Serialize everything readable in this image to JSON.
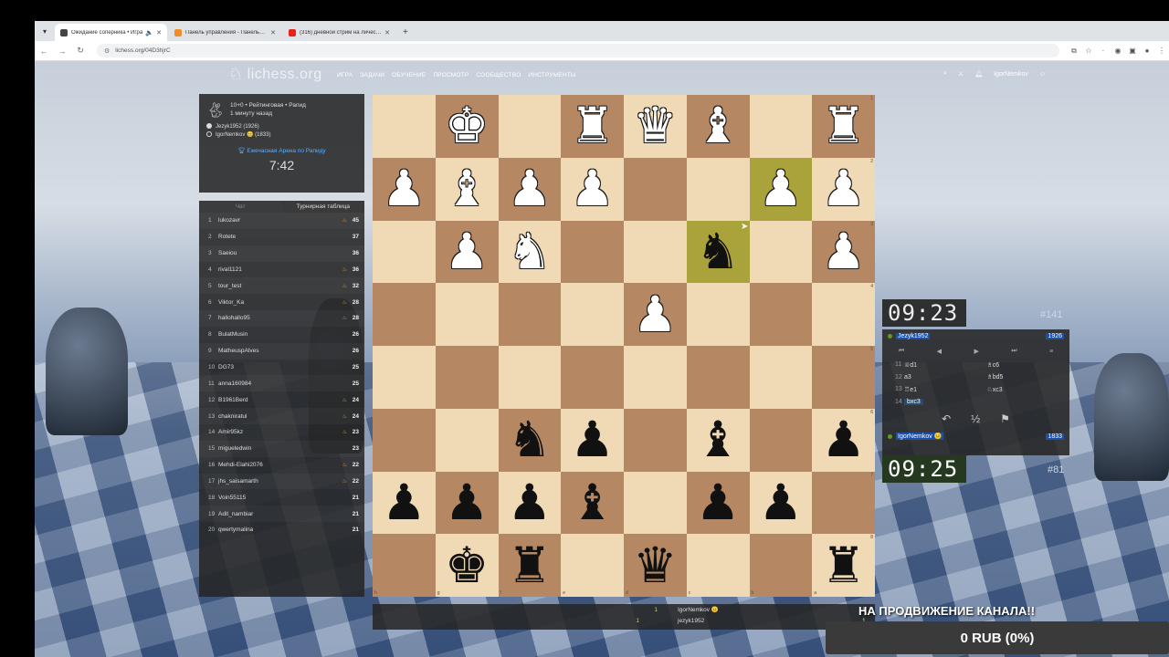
{
  "browser": {
    "tabs": [
      {
        "title": "Ожидание соперника • Игра",
        "active": true,
        "icon_color": "#444444"
      },
      {
        "title": "Панель управления - Панель…",
        "active": false,
        "icon_color": "#f28c28"
      },
      {
        "title": "(316) дневной стрим на личес…",
        "active": false,
        "icon_color": "#e62117"
      }
    ],
    "url": "lichess.org/04D3hjrC"
  },
  "site": {
    "logo": "lichess.org",
    "nav": [
      "ИГРА",
      "ЗАДАЧИ",
      "ОБУЧЕНИЕ",
      "ПРОСМОТР",
      "СООБЩЕСТВО",
      "ИНСТРУМЕНТЫ"
    ],
    "username": "IgorNemkov"
  },
  "game_info": {
    "line1": "10+0 • Рейтинговая • Рапид",
    "line2": "1 минуту назад",
    "white_player": "Jezyk1952 (1926)",
    "black_player": "IgorNemkov 😐 (1833)",
    "arena": "Ежечасная Арена по Рапиду",
    "arena_time": "7:42"
  },
  "tournament": {
    "tab_chat": "Чат",
    "tab_table": "Турнирная таблица",
    "rows": [
      {
        "rank": "1",
        "name": "lukozavr",
        "fire": true,
        "score": "45"
      },
      {
        "rank": "2",
        "name": "Rotete",
        "fire": false,
        "score": "37"
      },
      {
        "rank": "3",
        "name": "Saeiou",
        "fire": false,
        "score": "36"
      },
      {
        "rank": "4",
        "name": "rival1121",
        "fire": true,
        "score": "36"
      },
      {
        "rank": "5",
        "name": "tour_test",
        "fire": true,
        "score": "32"
      },
      {
        "rank": "6",
        "name": "Viktor_Ka",
        "fire": true,
        "score": "28"
      },
      {
        "rank": "7",
        "name": "hallohallo95",
        "fire": true,
        "score": "28"
      },
      {
        "rank": "8",
        "name": "BulatMusin",
        "fire": false,
        "score": "26"
      },
      {
        "rank": "9",
        "name": "MatheuspAlves",
        "fire": false,
        "score": "26"
      },
      {
        "rank": "10",
        "name": "DG73",
        "fire": false,
        "score": "25"
      },
      {
        "rank": "11",
        "name": "anna160984",
        "fire": false,
        "score": "25"
      },
      {
        "rank": "12",
        "name": "B1961Berd",
        "fire": true,
        "score": "24"
      },
      {
        "rank": "13",
        "name": "chakniratul",
        "fire": true,
        "score": "24"
      },
      {
        "rank": "14",
        "name": "Amir95kz",
        "fire": true,
        "score": "23"
      },
      {
        "rank": "15",
        "name": "migueledwin",
        "fire": false,
        "score": "23"
      },
      {
        "rank": "16",
        "name": "Mehdi-Elahi2076",
        "fire": true,
        "score": "22"
      },
      {
        "rank": "17",
        "name": "jhs_saisamarth",
        "fire": true,
        "score": "22"
      },
      {
        "rank": "18",
        "name": "Voin55115",
        "fire": false,
        "score": "21"
      },
      {
        "rank": "19",
        "name": "Adit_nambiar",
        "fire": false,
        "score": "21"
      },
      {
        "rank": "20",
        "name": "qwertymalina",
        "fire": false,
        "score": "21"
      }
    ]
  },
  "board": {
    "rows": [
      [
        "",
        "wK",
        "",
        "wR",
        "wQ",
        "wB",
        "",
        "wR"
      ],
      [
        "wP",
        "wB",
        "wP",
        "wP",
        "",
        "",
        "wP",
        "wP"
      ],
      [
        "",
        "wP",
        "wN",
        "",
        "",
        "bN",
        "",
        "wP"
      ],
      [
        "",
        "",
        "",
        "",
        "wP",
        "",
        "",
        ""
      ],
      [
        "",
        "",
        "",
        "",
        "",
        "",
        "",
        ""
      ],
      [
        "",
        "",
        "bN",
        "bP",
        "",
        "bB",
        "",
        "bP"
      ],
      [
        "bP",
        "bP",
        "bP",
        "bB",
        "",
        "bP",
        "bP",
        ""
      ],
      [
        "",
        "bK",
        "bR",
        "",
        "bQ",
        "",
        "",
        "bR"
      ]
    ],
    "highlights": [
      [
        1,
        6
      ],
      [
        2,
        5
      ]
    ],
    "rank_labels": [
      "1",
      "2",
      "3",
      "4",
      "5",
      "6",
      "7",
      "8"
    ],
    "file_labels": [
      "h",
      "g",
      "f",
      "e",
      "d",
      "c",
      "b",
      "a"
    ]
  },
  "clocks": {
    "opponent_time": "09:23",
    "opponent_rank": "#141",
    "player_time": "09:25",
    "player_rank": "#81"
  },
  "moves_panel": {
    "opponent": {
      "name": "Jezyk1952",
      "rating": "1926"
    },
    "player": {
      "name": "IgorNemkov 😐",
      "rating": "1833"
    },
    "moves": [
      {
        "num": "11",
        "white": "♕d1",
        "black": "♗c6"
      },
      {
        "num": "12",
        "white": "a3",
        "black": "♗bd5"
      },
      {
        "num": "13",
        "white": "♖e1",
        "black": "♘xc3"
      },
      {
        "num": "14",
        "white": "bxc3",
        "black": ""
      }
    ],
    "draw_label": "½"
  },
  "below_board": {
    "rows": [
      {
        "num": "1",
        "name": "IgorNemkov 😐",
        "points": "1"
      },
      {
        "num": "1",
        "name": "jezyk1952",
        "points": "1"
      }
    ]
  },
  "overlay": {
    "promo": "НА ПРОДВИЖЕНИЕ КАНАЛА!!",
    "donation": "0 RUB (0%)"
  }
}
